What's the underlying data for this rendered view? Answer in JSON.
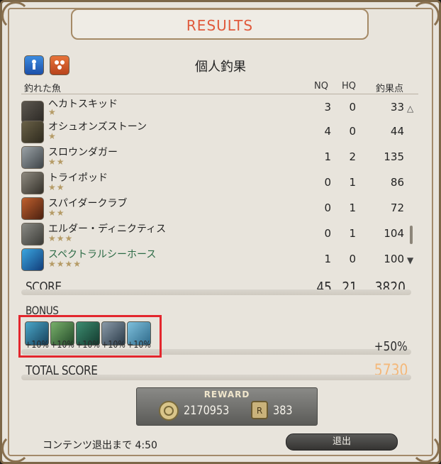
{
  "window": {
    "title": "RESULTS",
    "heading": "個人釣果"
  },
  "columns": {
    "fish": "釣れた魚",
    "nq": "NQ",
    "hq": "HQ",
    "points": "釣果点"
  },
  "fish": [
    {
      "name": "ヘカトスキッド",
      "stars": "★",
      "nq": "3",
      "hq": "0",
      "points": "33"
    },
    {
      "name": "オシュオンズストーン",
      "stars": "★",
      "nq": "4",
      "hq": "0",
      "points": "44"
    },
    {
      "name": "スロウンダガー",
      "stars": "★★",
      "nq": "1",
      "hq": "2",
      "points": "135"
    },
    {
      "name": "トライポッド",
      "stars": "★★",
      "nq": "0",
      "hq": "1",
      "points": "86"
    },
    {
      "name": "スパイダークラブ",
      "stars": "★★",
      "nq": "0",
      "hq": "1",
      "points": "72"
    },
    {
      "name": "エルダー・ディニクティス",
      "stars": "★★★",
      "nq": "0",
      "hq": "1",
      "points": "104"
    },
    {
      "name": "スペクトラルシーホース",
      "stars": "★★★★",
      "nq": "1",
      "hq": "0",
      "points": "100"
    }
  ],
  "score": {
    "label": "SCORE",
    "nq": "45",
    "hq": "21",
    "points": "3820"
  },
  "bonus": {
    "label": "BONUS",
    "items": [
      "+10%",
      "+10%",
      "+10%",
      "+10%",
      "+10%"
    ],
    "total": "+50%"
  },
  "total_score": {
    "label": "TOTAL SCORE",
    "value": "5730"
  },
  "reward": {
    "title": "REWARD",
    "gil": "2170953",
    "scrip": "383"
  },
  "footer": {
    "timer": "コンテンツ退出まで 4:50",
    "exit_label": "退出"
  },
  "colors": {
    "title": "#e05a3c",
    "total": "#f4b87a",
    "highlight_name": "#2d6b46",
    "bonus_border": "#e3262d"
  }
}
